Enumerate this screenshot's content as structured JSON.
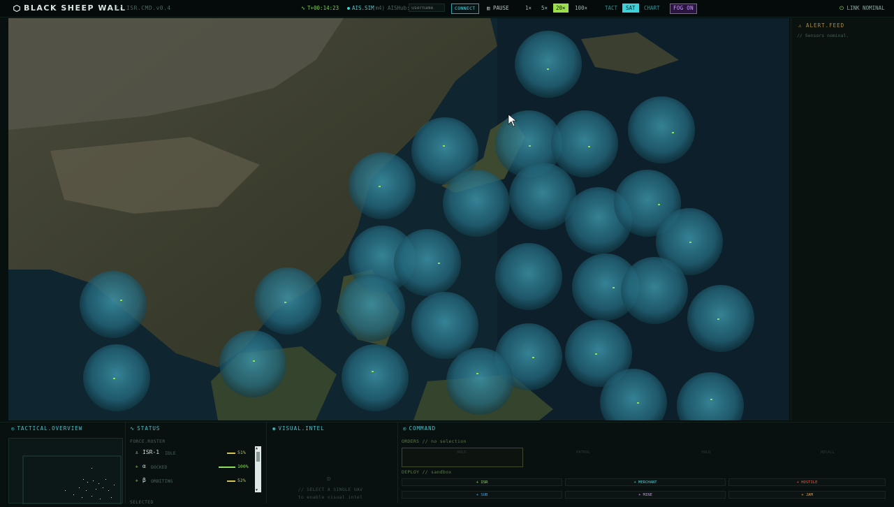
{
  "header": {
    "title": "BLACK SHEEP WALL",
    "version": "// ISR.CMD.v0.4",
    "timer": "T+00:14:23",
    "ais_label": "AIS.SIM",
    "ais_suffix": "(m4)",
    "aishub_label": "AISHub:",
    "aishub_placeholder": "username",
    "connect_label": "CONNECT",
    "pause_label": "PAUSE",
    "speeds": [
      "1×",
      "5×",
      "20×",
      "100×"
    ],
    "active_speed": "20×",
    "modes": [
      "TACT",
      "SAT",
      "CHART"
    ],
    "active_mode": "SAT",
    "fog_label": "FOG ON",
    "link_status": "LINK NOMINAL"
  },
  "alert_feed": {
    "title": "ALERT.FEED",
    "messages": [
      "// Sensors nominal."
    ]
  },
  "tactical_overview": {
    "title": "TACTICAL.OVERVIEW"
  },
  "status": {
    "title": "STATUS",
    "roster_label": "FORCE.ROSTER",
    "units": [
      {
        "name": "ISR-1",
        "state": "IDLE",
        "pct": "51%",
        "fraction": 0.51,
        "color": "#d9c34a"
      },
      {
        "name": "α",
        "state": "DOCKED",
        "pct": "100%",
        "fraction": 1.0,
        "color": "#8fe05a"
      },
      {
        "name": "β",
        "state": "ORBITING",
        "pct": "52%",
        "fraction": 0.52,
        "color": "#d9c34a"
      }
    ],
    "selected_label": "SELECTED"
  },
  "visual_intel": {
    "title": "VISUAL.INTEL",
    "line1": "// SELECT A SINGLE UAV",
    "line2": "to enable visual intel"
  },
  "command": {
    "title": "COMMAND",
    "orders_label": "ORDERS // no selection",
    "orders": [
      "HOLD",
      "PATROL",
      "HOLD",
      "RECALL"
    ],
    "deploy_label": "DEPLOY // sandbox",
    "deploy": [
      {
        "label": "+ ISR",
        "color": "#8fe05a"
      },
      {
        "label": "+ MERCHANT",
        "color": "#5fc2c8"
      },
      {
        "label": "+ HOSTILE",
        "color": "#e0584a"
      },
      {
        "label": "+ SUB",
        "color": "#4aa0e0"
      },
      {
        "label": "+ MINE",
        "color": "#c08ae0"
      },
      {
        "label": "+ JAM",
        "color": "#e0a04a"
      }
    ]
  },
  "colors": {
    "accent": "#3fd0d8",
    "friendly": "#8fe05a",
    "warning": "#d9c34a",
    "fog": "#8f4fd0"
  }
}
